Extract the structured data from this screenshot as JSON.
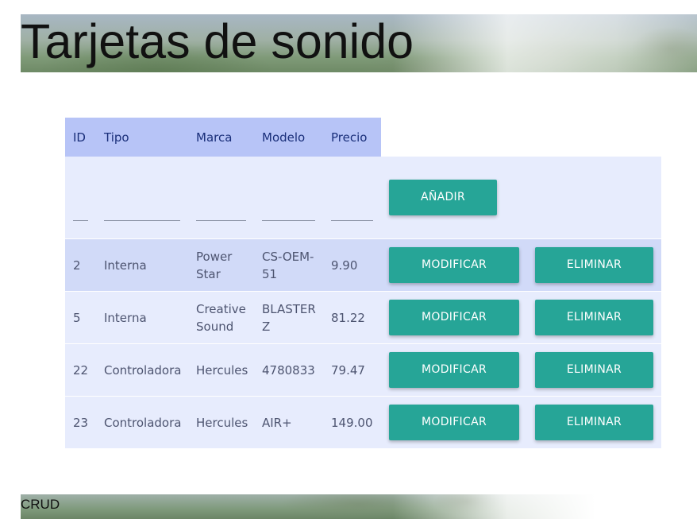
{
  "page": {
    "title": "Tarjetas de sonido",
    "footer_text": "CRUD"
  },
  "table": {
    "headers": {
      "id": "ID",
      "tipo": "Tipo",
      "marca": "Marca",
      "modelo": "Modelo",
      "precio": "Precio"
    },
    "add_form": {
      "id_value": "",
      "tipo_value": "",
      "marca_value": "",
      "modelo_value": "",
      "precio_value": "",
      "add_label": "AÑADIR"
    },
    "rows": [
      {
        "id": "2",
        "tipo": "Interna",
        "marca": "Power Star",
        "modelo": "CS-OEM-51",
        "precio": "9.90"
      },
      {
        "id": "5",
        "tipo": "Interna",
        "marca": "Creative Sound",
        "modelo": "BLASTER Z",
        "precio": "81.22"
      },
      {
        "id": "22",
        "tipo": "Controladora",
        "marca": "Hercules",
        "modelo": "4780833",
        "precio": "79.47"
      },
      {
        "id": "23",
        "tipo": "Controladora",
        "marca": "Hercules",
        "modelo": "AIR+",
        "precio": "149.00"
      }
    ],
    "modify_label": "MODIFICAR",
    "delete_label": "ELIMINAR"
  },
  "colors": {
    "header_bg": "#b7c4f7",
    "header_text": "#1a2f7a",
    "row_highlight": "#d1daf8",
    "row_bg": "#e7ecfd",
    "button_bg": "#26a597"
  }
}
